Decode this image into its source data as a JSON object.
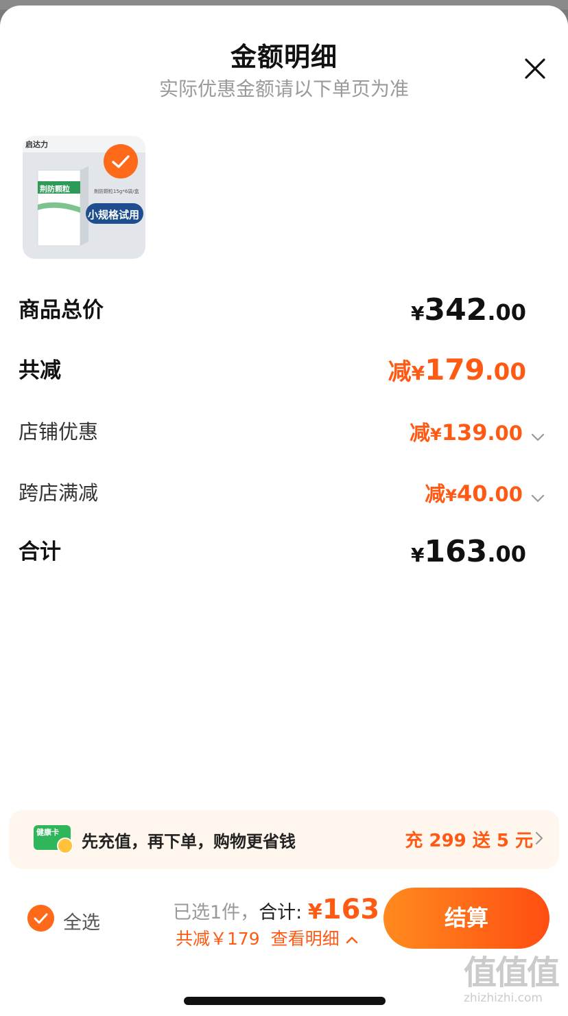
{
  "header": {
    "title": "金额明细",
    "subtitle": "实际优惠金额请以下单页为准"
  },
  "icons": {
    "close": "close-icon",
    "check": "check-icon",
    "chevron": "chevron-down-icon",
    "health_card": "health-card-icon"
  },
  "product": {
    "brand": "启达力",
    "name": "荆防颗粒",
    "spec": "荆防颗粒15g*6袋/盒",
    "tag": "小规格试用",
    "selected": true
  },
  "breakdown": {
    "total_price": {
      "label": "商品总价",
      "currency": "¥",
      "int": "342",
      "dec": ".00"
    },
    "total_discount": {
      "label": "共减",
      "prefix": "减",
      "currency": "¥",
      "int": "179",
      "dec": ".00"
    },
    "shop_discount": {
      "label": "店铺优惠",
      "prefix": "减",
      "currency": "¥",
      "int": "139",
      "dec": ".00"
    },
    "cross_store": {
      "label": "跨店满减",
      "prefix": "减",
      "currency": "¥",
      "int": "40",
      "dec": ".00"
    },
    "subtotal": {
      "label": "合计",
      "currency": "¥",
      "int": "163",
      "dec": ".00"
    }
  },
  "promo": {
    "card_label": "健康卡",
    "text": "先充值，再下单，购物更省钱",
    "cta": "充 299 送 5 元"
  },
  "footer": {
    "select_all": "全选",
    "selected_count": "已选1件，",
    "total_label": "合计:",
    "total_currency": "¥",
    "total_amount": "163",
    "discount_text": "共减￥179",
    "detail_link": "查看明细",
    "checkout": "结算"
  },
  "watermark": {
    "main": "值值值",
    "sub": "zhizhizhi.com"
  },
  "colors": {
    "accent": "#ff5a14",
    "button_start": "#ff8a1e",
    "button_end": "#ff4e12",
    "promo_bg": "#fff6ee"
  }
}
